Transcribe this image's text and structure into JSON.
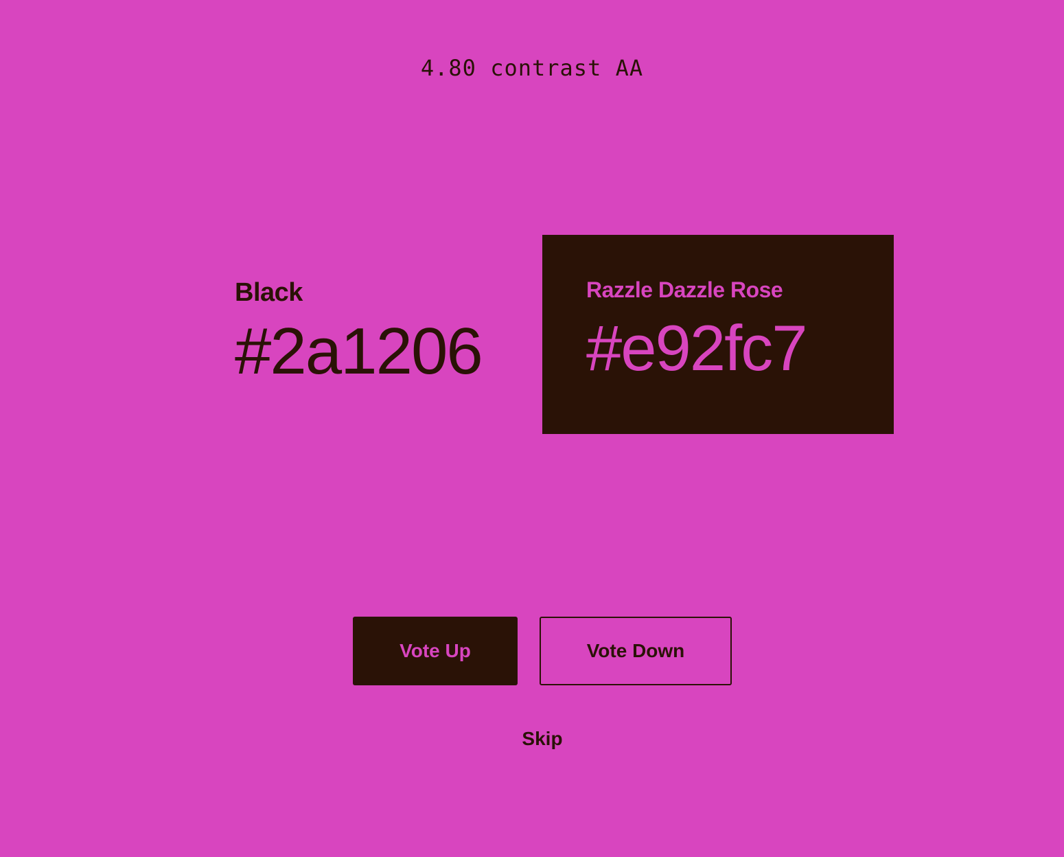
{
  "header": {
    "contrast_text": "4.80 contrast AA"
  },
  "colors": {
    "background": "#d845bf",
    "foreground": "#2a1206"
  },
  "left_swatch": {
    "name": "Black",
    "hex": "#2a1206"
  },
  "right_swatch": {
    "name": "Razzle Dazzle Rose",
    "hex": "#e92fc7"
  },
  "actions": {
    "vote_up": "Vote Up",
    "vote_down": "Vote Down",
    "skip": "Skip"
  }
}
